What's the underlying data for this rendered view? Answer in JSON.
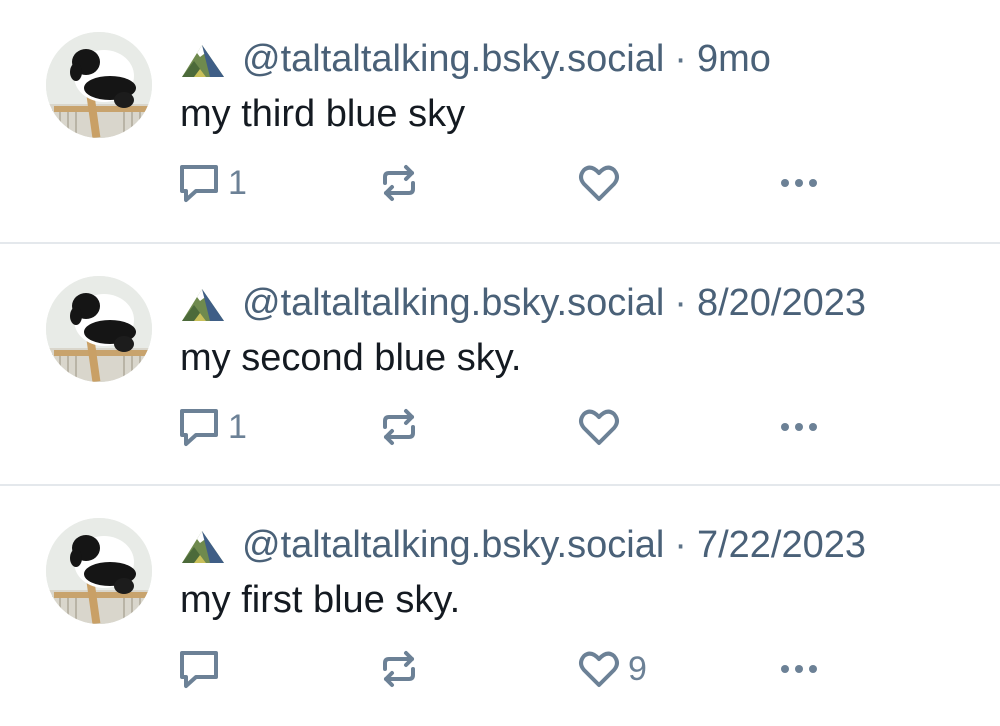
{
  "colors": {
    "meta": "#4a6178",
    "icon": "#6c8196",
    "divider": "#e4e8ec"
  },
  "posts": [
    {
      "handle": "@taltaltalking.bsky.social",
      "separator": "·",
      "time": "9mo",
      "text": "my third blue sky",
      "reply_count": "1",
      "repost_count": "",
      "like_count": ""
    },
    {
      "handle": "@taltaltalking.bsky.social",
      "separator": "·",
      "time": "8/20/2023",
      "text": "my second blue sky.",
      "reply_count": "1",
      "repost_count": "",
      "like_count": ""
    },
    {
      "handle": "@taltaltalking.bsky.social",
      "separator": "·",
      "time": "7/22/2023",
      "text": "my first blue sky.",
      "reply_count": "",
      "repost_count": "",
      "like_count": "9"
    }
  ],
  "icons": {
    "mountain": "mountain-emoji-icon",
    "reply": "reply-bubble-icon",
    "repost": "repost-arrows-icon",
    "like": "heart-icon",
    "more": "more-dots-icon"
  }
}
